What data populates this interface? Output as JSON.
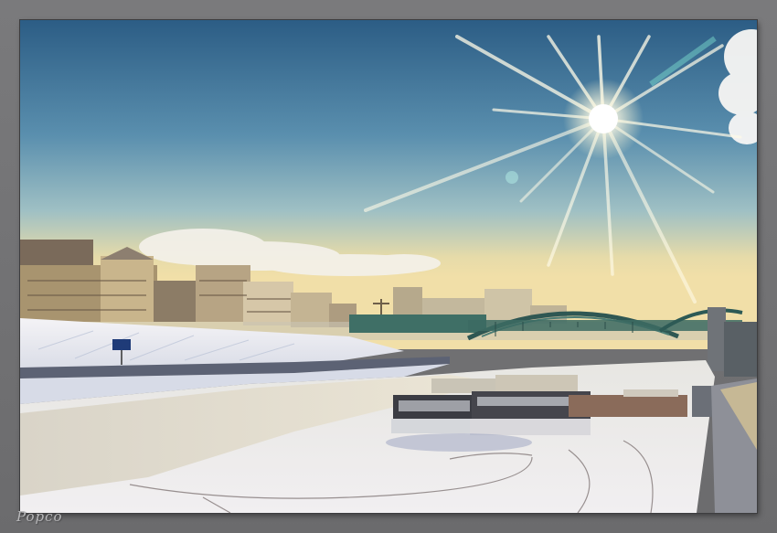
{
  "image": {
    "description_tag": "winter-river-bridge-sunburst",
    "colors": {
      "sky_top": "#2f5f86",
      "sky_mid": "#6f9fb6",
      "sky_horizon": "#e7d8a6",
      "ice": "#e9e7e9",
      "frame": "#6f6f71",
      "sun": "#ffffff"
    }
  },
  "watermark": {
    "signature": "Popco"
  }
}
